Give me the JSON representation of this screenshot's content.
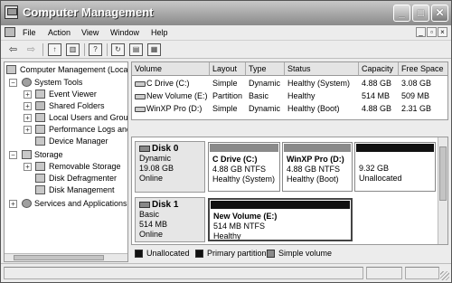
{
  "window": {
    "title": "Computer Management"
  },
  "menu": [
    "File",
    "Action",
    "View",
    "Window",
    "Help"
  ],
  "tree": {
    "root": "Computer Management (Local)",
    "system_tools": "System Tools",
    "event_viewer": "Event Viewer",
    "shared_folders": "Shared Folders",
    "local_users": "Local Users and Groups",
    "perf_logs": "Performance Logs and Alerts",
    "device_manager": "Device Manager",
    "storage": "Storage",
    "removable_storage": "Removable Storage",
    "disk_defrag": "Disk Defragmenter",
    "disk_management": "Disk Management",
    "services": "Services and Applications"
  },
  "volumes": {
    "columns": [
      "Volume",
      "Layout",
      "Type",
      "Status",
      "Capacity",
      "Free Space"
    ],
    "rows": [
      [
        "C Drive (C:)",
        "Simple",
        "Dynamic",
        "Healthy (System)",
        "4.88 GB",
        "3.08 GB"
      ],
      [
        "New Volume (E:)",
        "Partition",
        "Basic",
        "Healthy",
        "514 MB",
        "509 MB"
      ],
      [
        "WinXP Pro (D:)",
        "Simple",
        "Dynamic",
        "Healthy (Boot)",
        "4.88 GB",
        "2.31 GB"
      ]
    ]
  },
  "disks": [
    {
      "name": "Disk 0",
      "type": "Dynamic",
      "size": "19.08 GB",
      "status": "Online",
      "partitions": [
        {
          "name": "C Drive  (C:)",
          "size": "4.88 GB NTFS",
          "status": "Healthy (System)"
        },
        {
          "name": "WinXP Pro  (D:)",
          "size": "4.88 GB NTFS",
          "status": "Healthy (Boot)"
        },
        {
          "name": "",
          "size": "9.32 GB",
          "status": "Unallocated"
        }
      ]
    },
    {
      "name": "Disk 1",
      "type": "Basic",
      "size": "514 MB",
      "status": "Online",
      "partitions": [
        {
          "name": "New Volume  (E:)",
          "size": "514 MB NTFS",
          "status": "Healthy"
        }
      ]
    }
  ],
  "legend": [
    {
      "label": "Unallocated",
      "color": "#111111"
    },
    {
      "label": "Primary partition",
      "color": "#111111"
    },
    {
      "label": "Simple volume",
      "color": "#8a8a8a"
    }
  ]
}
